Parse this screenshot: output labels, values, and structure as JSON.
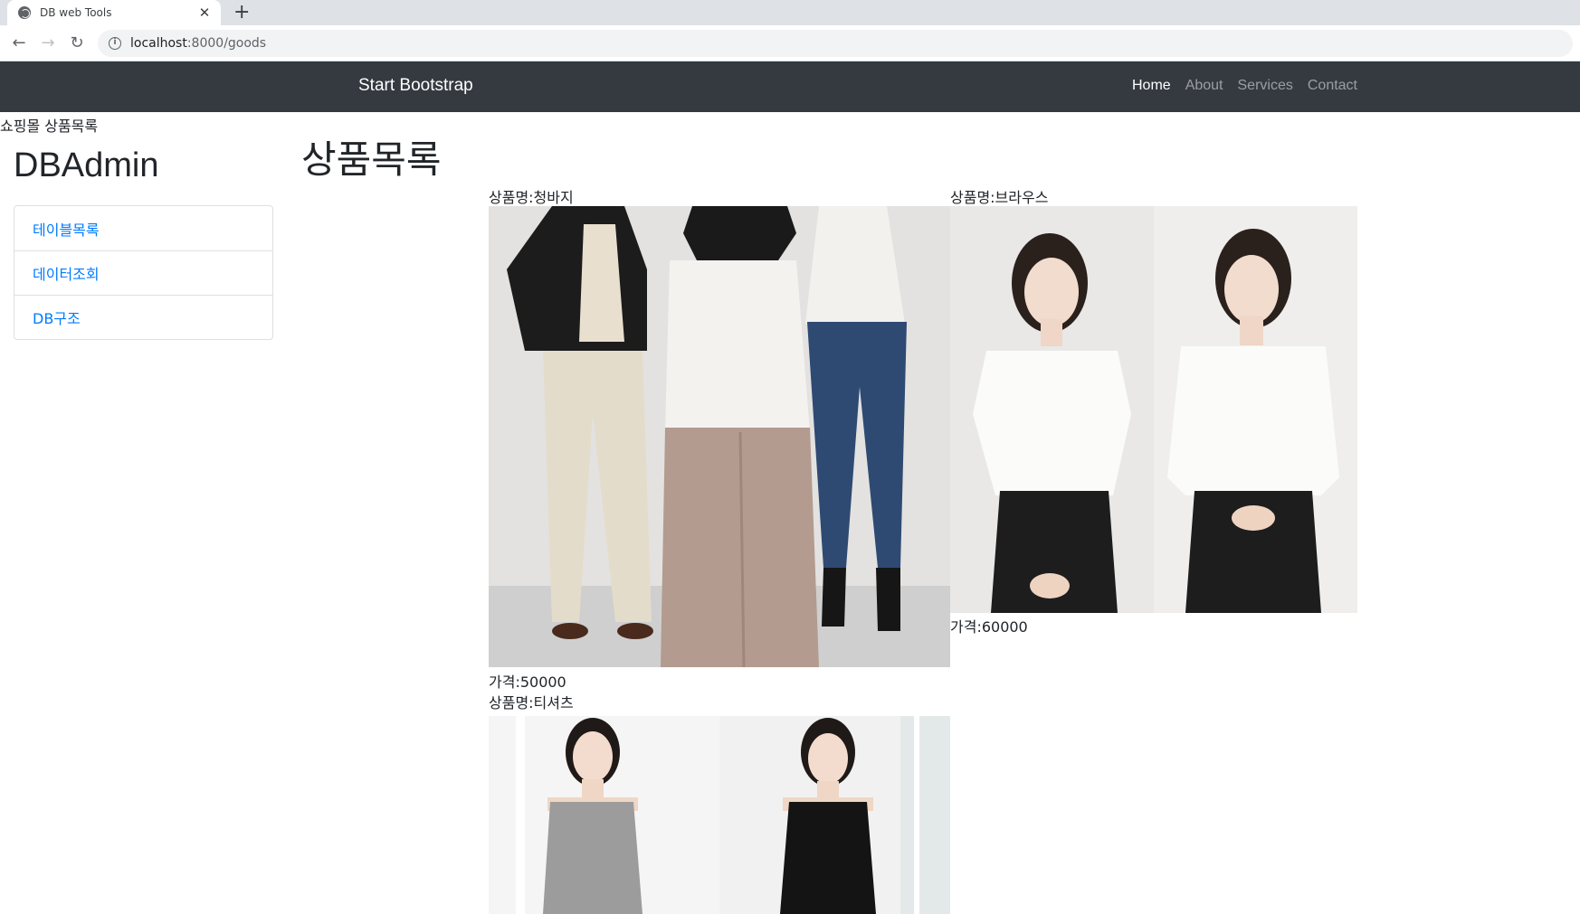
{
  "browser": {
    "tab_title": "DB web Tools",
    "tab_close": "✕",
    "new_tab": "+",
    "back": "←",
    "forward": "→",
    "reload": "↻",
    "url_host": "localhost",
    "url_path": ":8000/goods"
  },
  "navbar": {
    "brand": "Start Bootstrap",
    "links": [
      "Home",
      "About",
      "Services",
      "Contact"
    ]
  },
  "page_caption": "쇼핑몰 상품목록",
  "sidebar": {
    "title": "DBAdmin",
    "items": [
      "테이블목록",
      "데이터조회",
      "DB구조"
    ]
  },
  "main": {
    "title": "상품목록",
    "products": [
      {
        "name_label": "상품명:청바지",
        "price_label": "가격:50000"
      },
      {
        "name_label": "상품명:브라우스",
        "price_label": "가격:60000"
      },
      {
        "name_label": "상품명:티셔츠"
      }
    ]
  },
  "colors": {
    "navbar_bg": "#343a40",
    "link": "#007bff"
  }
}
